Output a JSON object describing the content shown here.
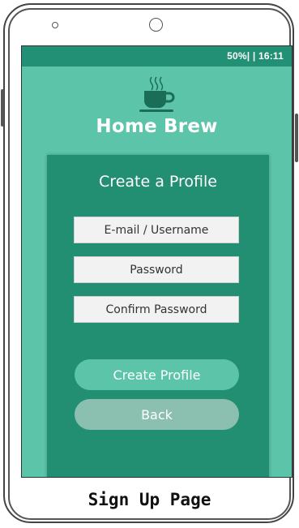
{
  "status_bar": {
    "text": "50%| | 16:11"
  },
  "app": {
    "title": "Home Brew",
    "logo_icon": "coffee-cup-icon"
  },
  "form": {
    "title": "Create a Profile",
    "email_placeholder": "E-mail / Username",
    "password_placeholder": "Password",
    "confirm_placeholder": "Confirm Password",
    "email_value": "",
    "password_value": "",
    "confirm_value": ""
  },
  "buttons": {
    "create_label": "Create Profile",
    "back_label": "Back"
  },
  "caption": "Sign Up Page",
  "colors": {
    "screen_bg": "#5cc4a8",
    "card_bg": "#228f72",
    "status_bar": "#229074",
    "button_primary": "#5cc4a8",
    "button_secondary": "#8bbfb0"
  }
}
